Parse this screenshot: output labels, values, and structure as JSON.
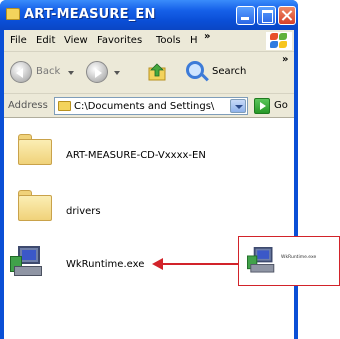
{
  "window": {
    "title": "ART-MEASURE_EN"
  },
  "menubar": {
    "items": [
      "File",
      "Edit",
      "View",
      "Favorites",
      "Tools",
      "H"
    ],
    "overflow": "»"
  },
  "toolbar": {
    "back_label": "Back",
    "search_label": "Search",
    "overflow": "»"
  },
  "address": {
    "label": "Address",
    "value": "C:\\Documents and Settings\\",
    "go_label": "Go"
  },
  "files": [
    {
      "name": "ART-MEASURE-CD-Vxxxx-EN",
      "type": "folder"
    },
    {
      "name": "drivers",
      "type": "folder"
    },
    {
      "name": "WkRuntime.exe",
      "type": "executable"
    }
  ],
  "callout": {
    "label": "WkRuntime.exe"
  },
  "colors": {
    "title_bar": "#0a4fd6",
    "chrome": "#ece9d8",
    "callout_accent": "#d2232a"
  }
}
